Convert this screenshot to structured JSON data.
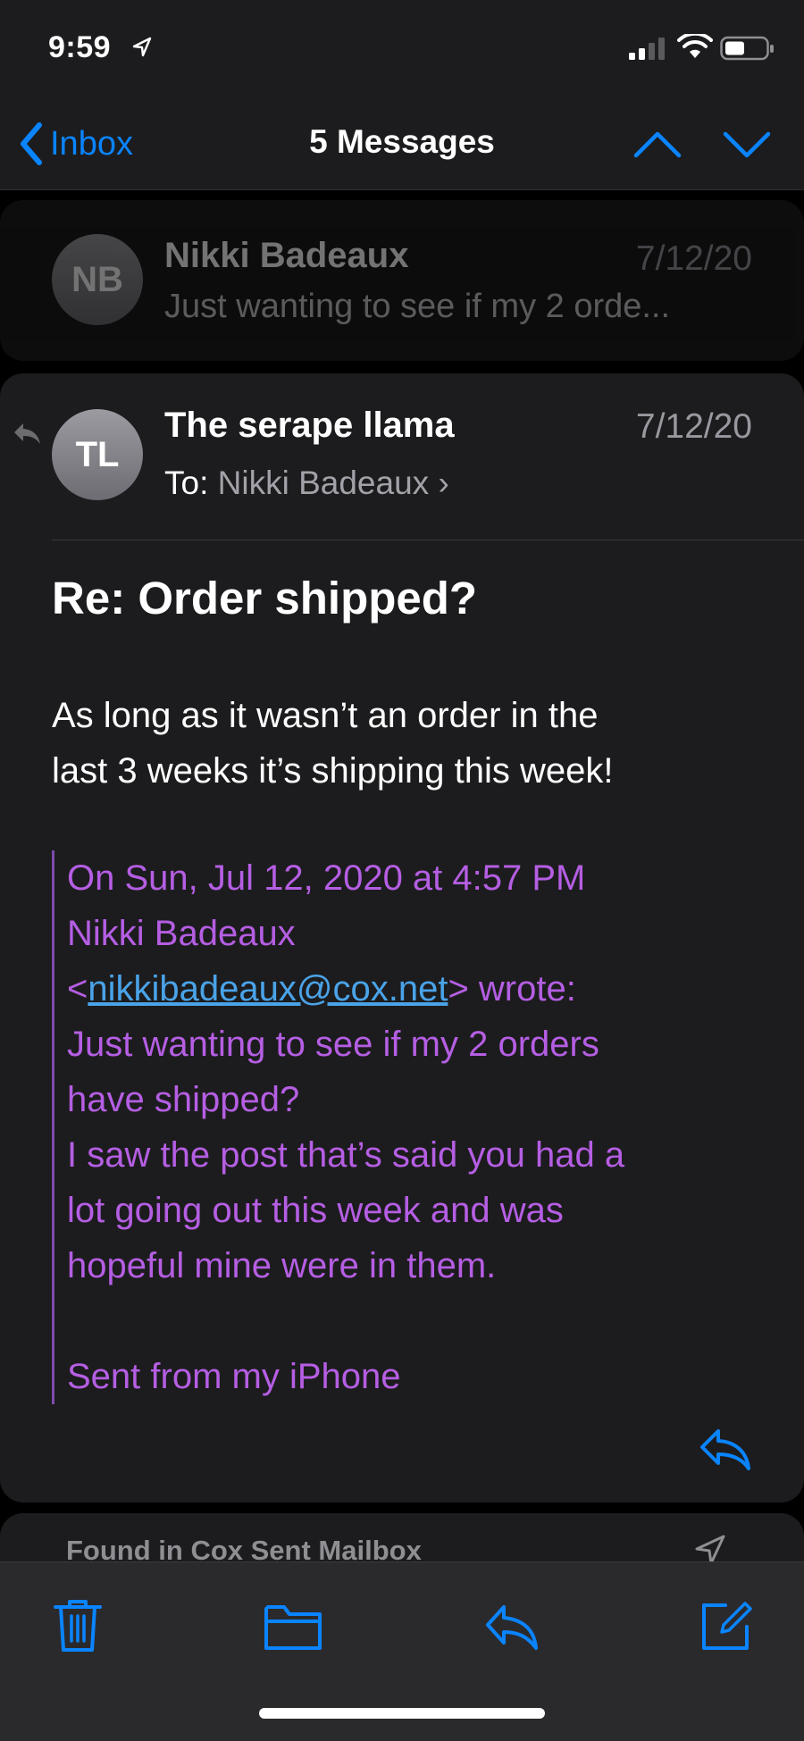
{
  "status_bar": {
    "time": "9:59",
    "icons": [
      "location-arrow-icon",
      "cellular-signal-icon",
      "wifi-icon",
      "battery-icon"
    ]
  },
  "nav": {
    "back_label": "Inbox",
    "title": "5 Messages",
    "icons": [
      "chevron-left-icon",
      "chevron-up-icon",
      "chevron-down-icon"
    ]
  },
  "collapsed_message": {
    "avatar_initials": "NB",
    "sender": "Nikki Badeaux",
    "date": "7/12/20",
    "preview": "Just wanting to see if my 2 orde..."
  },
  "open_message": {
    "avatar_initials": "TL",
    "sender": "The serape llama",
    "date": "7/12/20",
    "to_label": "To:",
    "to_name": "Nikki Badeaux",
    "to_chevron": "›",
    "subject": "Re:  Order shipped?",
    "body_lines": [
      "As long as it wasn’t an order in the",
      "last 3 weeks it’s shipping this week!"
    ],
    "quote": {
      "line1": "On Sun, Jul 12, 2020 at 4:57 PM",
      "line2": "Nikki Badeaux",
      "email_open": "<",
      "email": "nikkibadeaux@cox.net",
      "email_close": "> wrote:",
      "text_lines": [
        "Just wanting to see if my 2 orders",
        "have shipped?",
        "I saw the post that’s said you had a",
        "lot going out this week and was",
        "hopeful mine were in them."
      ],
      "signature": "Sent from my iPhone"
    }
  },
  "found_in": {
    "label": "Found in Cox Sent Mailbox",
    "icon": "paper-plane-icon"
  },
  "toolbar": {
    "icons": [
      "trash-icon",
      "folder-icon",
      "reply-icon",
      "compose-icon"
    ]
  },
  "colors": {
    "accent": "#0a84ff",
    "quote": "#b55ee3",
    "link": "#4aa3e8",
    "card": "#1c1c1e"
  }
}
